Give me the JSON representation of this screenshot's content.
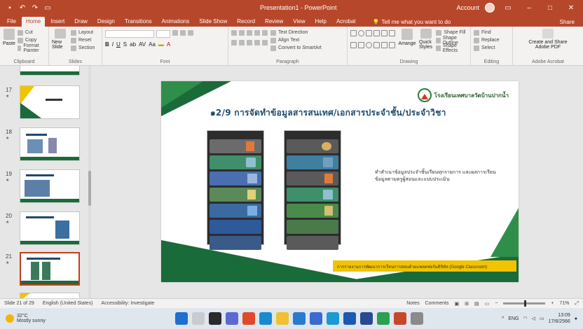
{
  "window": {
    "title": "Presentation1 - PowerPoint",
    "user_name": "Account",
    "colors": {
      "accent": "#b7472a",
      "ribbon_bg": "#f3f2f1"
    }
  },
  "qat": {
    "save_icon": "save-icon",
    "undo_icon": "undo-icon",
    "redo_icon": "redo-icon",
    "present_icon": "present-icon"
  },
  "tabs": [
    {
      "label": "File"
    },
    {
      "label": "Home"
    },
    {
      "label": "Insert"
    },
    {
      "label": "Draw"
    },
    {
      "label": "Design"
    },
    {
      "label": "Transitions"
    },
    {
      "label": "Animations"
    },
    {
      "label": "Slide Show"
    },
    {
      "label": "Record"
    },
    {
      "label": "Review"
    },
    {
      "label": "View"
    },
    {
      "label": "Help"
    },
    {
      "label": "Acrobat"
    }
  ],
  "tell_me": "Tell me what you want to do",
  "share": "Share",
  "ribbon": {
    "clipboard": {
      "label": "Clipboard",
      "paste": "Paste",
      "cut": "Cut",
      "copy": "Copy",
      "format_painter": "Format Painter"
    },
    "slides": {
      "label": "Slides",
      "new_slide": "New Slide",
      "layout": "Layout",
      "reset": "Reset",
      "section": "Section"
    },
    "font": {
      "label": "Font"
    },
    "paragraph": {
      "label": "Paragraph",
      "text_direction": "Text Direction",
      "align_text": "Align Text",
      "smartart": "Convert to SmartArt"
    },
    "drawing": {
      "label": "Drawing",
      "arrange": "Arrange",
      "quick_styles": "Quick Styles",
      "shape_fill": "Shape Fill",
      "shape_outline": "Shape Outline",
      "shape_effects": "Shape Effects"
    },
    "editing": {
      "label": "Editing",
      "find": "Find",
      "replace": "Replace",
      "select": "Select"
    },
    "acrobat": {
      "label": "Adobe Acrobat",
      "create_share": "Create and Share Adobe PDF"
    }
  },
  "thumbnails": [
    {
      "num": "",
      "active": false
    },
    {
      "num": "17",
      "active": false
    },
    {
      "num": "18",
      "active": false
    },
    {
      "num": "19",
      "active": false
    },
    {
      "num": "20",
      "active": false
    },
    {
      "num": "21",
      "active": true
    },
    {
      "num": "",
      "active": false
    }
  ],
  "slide": {
    "title": "๑2/9 การจัดทำข้อมูลสารสนเทศ/เอกสารประจำชั้น/ประจำวิชา",
    "logo_text": "โรงเรียนเทศบาลวัดบ้านปากน้ำ",
    "description": "ทำสำเนาข้อมูลประจำชั้นเรียนทุกรายการ และผลการเรียนข้อมูลตามครูผู้สอนและแบบประเมิน",
    "footer_note": "การรายงานการพัฒนาการเรียนการสอนด้วยแพลตฟอร์มดิจิทัล (Google Classroom)"
  },
  "statusbar": {
    "slide_info": "Slide 21 of 29",
    "language": "English (United States)",
    "accessibility": "Accessibility: Investigate",
    "notes": "Notes",
    "comments": "Comments",
    "zoom": "71%"
  },
  "taskbar": {
    "temp": "32°C",
    "weather": "Mostly sunny",
    "time": "13:09",
    "date": "17/6/2566",
    "lang": "ENG"
  }
}
